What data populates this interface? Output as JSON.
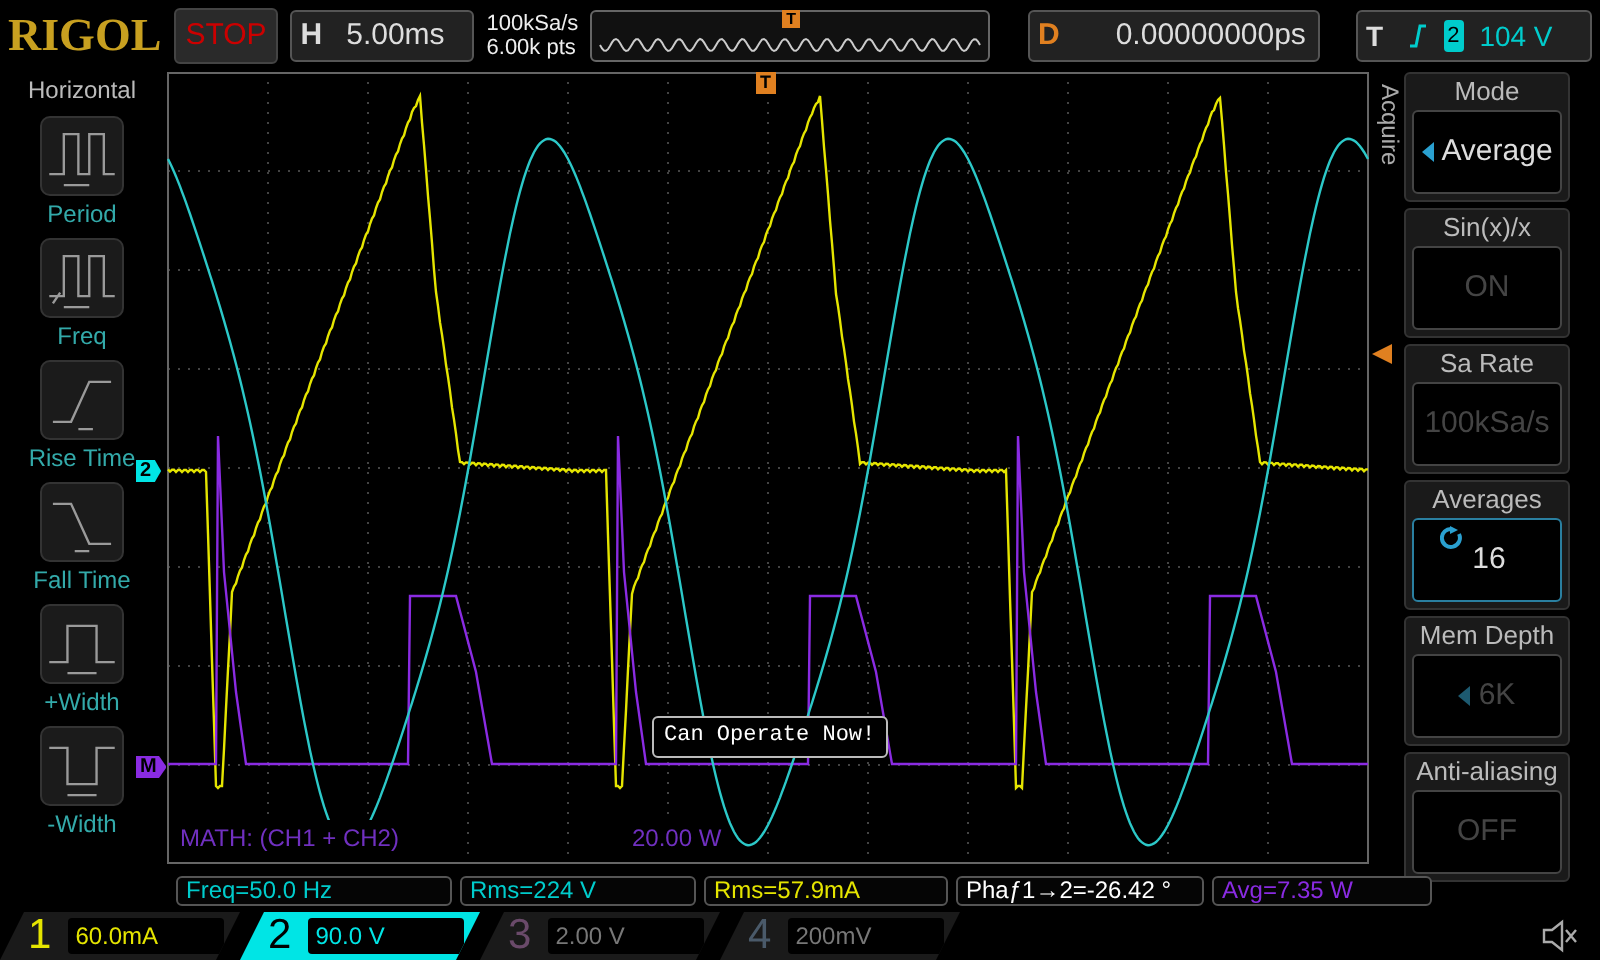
{
  "header": {
    "logo": "RIGOL",
    "run_state": "STOP",
    "timebase_label": "H",
    "timebase": "5.00ms",
    "sample_rate": "100kSa/s",
    "memory": "6.00k pts",
    "delay_label": "D",
    "delay": "0.00000000ps",
    "overview_marker": "T",
    "trigger_label": "T",
    "trigger_source": "2",
    "trigger_level": "104 V"
  },
  "left_menu": {
    "title": "Horizontal",
    "items": [
      {
        "label": "Period",
        "kind": "period"
      },
      {
        "label": "Freq",
        "kind": "freq"
      },
      {
        "label": "Rise Time",
        "kind": "rise"
      },
      {
        "label": "Fall Time",
        "kind": "fall"
      },
      {
        "label": "+Width",
        "kind": "pwidth"
      },
      {
        "label": "-Width",
        "kind": "nwidth"
      }
    ]
  },
  "display": {
    "trigger_marker": "T",
    "channel_markers": [
      {
        "label": "2",
        "color": "#00e5e5"
      },
      {
        "label": "M",
        "color": "#8a2be2"
      }
    ],
    "math_label": "MATH:  (CH1 + CH2)",
    "math_scale": "20.00 W",
    "message": "Can Operate Now!"
  },
  "measurements": [
    {
      "text": "Freq=50.0 Hz",
      "color": "#00cccc"
    },
    {
      "text": "Rms=224 V",
      "color": "#00cccc"
    },
    {
      "text": "Rms=57.9mA",
      "color": "#e5e500"
    },
    {
      "text": "Phaƒ1→2=-26.42 °",
      "color": "#ffffff"
    },
    {
      "text": "Avg=7.35 W",
      "color": "#8a2be2"
    }
  ],
  "right_menu": {
    "section": "Acquire",
    "items": [
      {
        "title": "Mode",
        "value": "Average",
        "kind": "select",
        "disabled": false,
        "selected": false
      },
      {
        "title": "Sin(x)/x",
        "value": "ON",
        "kind": "plain",
        "disabled": true,
        "selected": false
      },
      {
        "title": "Sa Rate",
        "value": "100kSa/s",
        "kind": "plain",
        "disabled": true,
        "selected": false
      },
      {
        "title": "Averages",
        "value": "16",
        "kind": "knob",
        "disabled": false,
        "selected": true
      },
      {
        "title": "Mem Depth",
        "value": "6K",
        "kind": "select",
        "disabled": true,
        "selected": false
      },
      {
        "title": "Anti-aliasing",
        "value": "OFF",
        "kind": "plain",
        "disabled": true,
        "selected": false
      }
    ]
  },
  "channels": [
    {
      "number": "1",
      "scale": "60.0mA",
      "on": true,
      "selected": false,
      "color": "#e5e500"
    },
    {
      "number": "2",
      "scale": "90.0 V",
      "on": true,
      "selected": true,
      "color": "#00e5e5"
    },
    {
      "number": "3",
      "scale": "2.00 V",
      "on": false,
      "selected": false,
      "color": "#6a4a6a"
    },
    {
      "number": "4",
      "scale": "200mV",
      "on": false,
      "selected": false,
      "color": "#4a5a6a"
    }
  ]
}
